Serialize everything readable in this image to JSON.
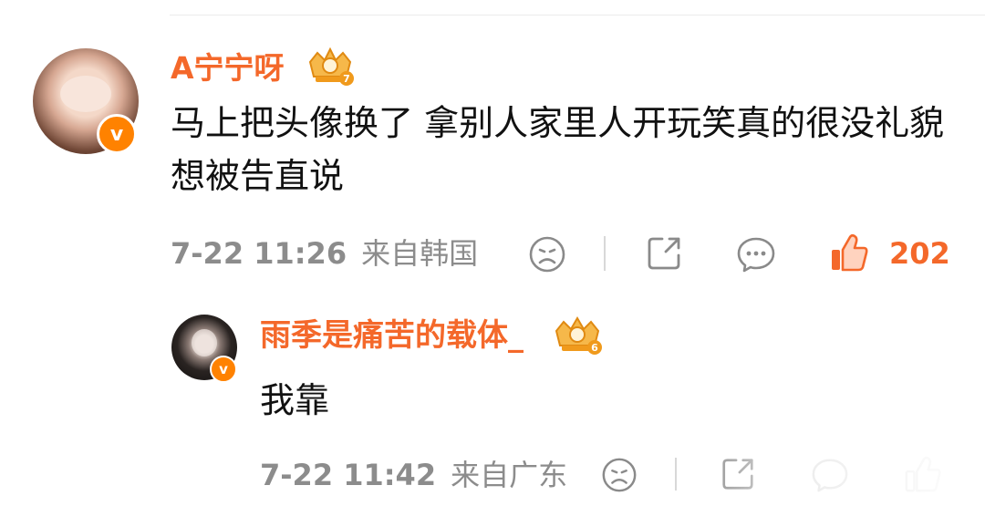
{
  "comment": {
    "username": "A宁宁呀",
    "text": "马上把头像换了 拿别人家里人开玩笑真的很没礼貌 想被告直说",
    "time": "7-22 11:26",
    "source": "来自韩国",
    "likes": "202",
    "badge_level": "7",
    "verified_symbol": "v"
  },
  "reply": {
    "username": "雨季是痛苦的载体_",
    "text": "我靠",
    "time": "7-22 11:42",
    "source": "来自广东",
    "badge_level": "6",
    "verified_symbol": "v"
  },
  "icons": {
    "dislike": "sad-face-icon",
    "share": "share-icon",
    "comment": "comment-icon",
    "like": "thumbs-up-icon",
    "badge": "crown-badge-icon"
  },
  "colors": {
    "accent": "#f4682a",
    "verified": "#ff8200",
    "meta": "#8c8c8c"
  }
}
